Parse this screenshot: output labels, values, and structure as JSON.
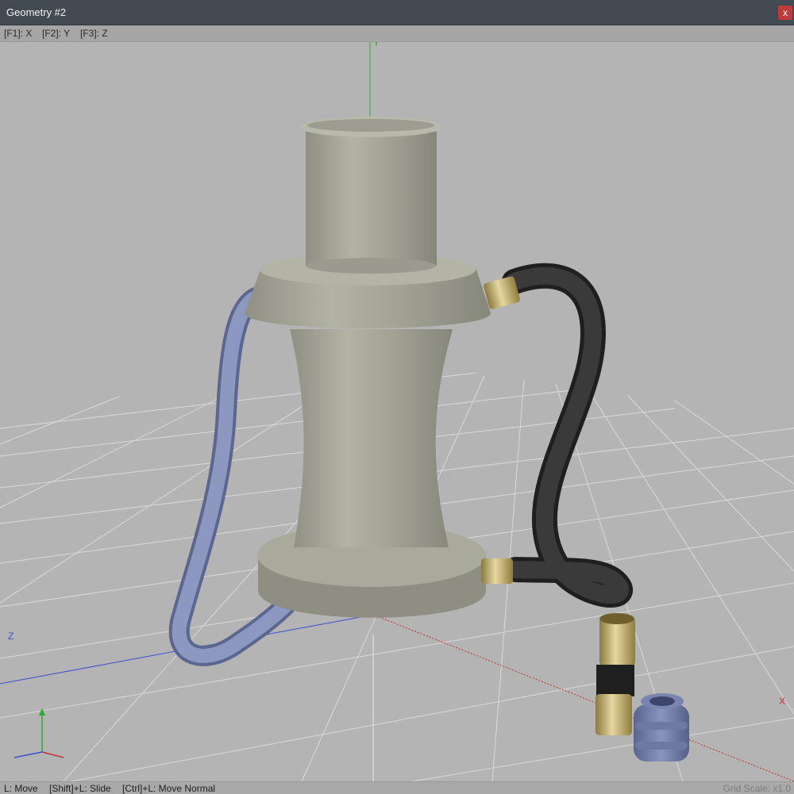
{
  "window": {
    "title": "Geometry #2",
    "close_label": "x"
  },
  "keybar": {
    "items": [
      "[F1]: X",
      "[F2]: Y",
      "[F3]: Z"
    ]
  },
  "viewport": {
    "axis_labels": {
      "x": "X",
      "y": "Y",
      "z": "Z"
    },
    "colors": {
      "background": "#b4b4b4",
      "grid": "#d9d9d9",
      "x_axis": "#c43232",
      "y_axis": "#2ea82e",
      "z_axis": "#3c4fd0",
      "body": "#a7a89a",
      "ribbed_hose": "#7380a8",
      "black_hose": "#2a2a2a",
      "brass": "#c9b36e"
    }
  },
  "statusbar": {
    "hints": [
      "L: Move",
      "[Shift]+L: Slide",
      "[Ctrl]+L: Move Normal"
    ],
    "grid_scale": "Grid Scale: x1.0"
  }
}
